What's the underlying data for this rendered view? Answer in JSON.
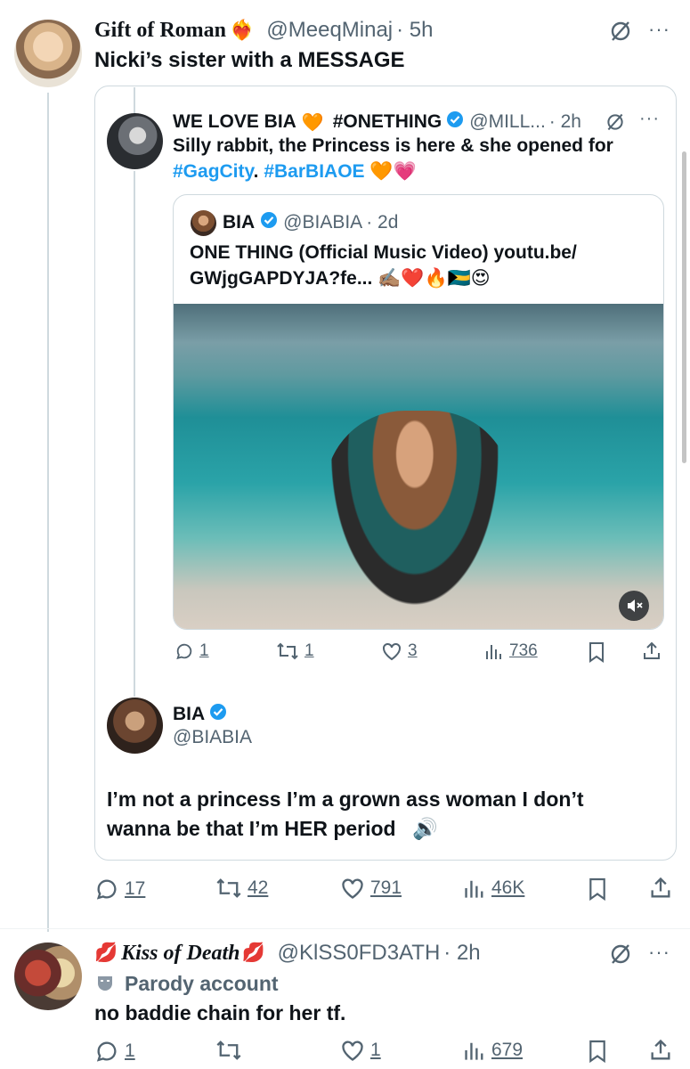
{
  "tweet1": {
    "display_name": "Gift of Roman",
    "display_emoji": "❤️‍🔥",
    "handle": "@MeeqMinaj",
    "time": "· 5h",
    "text": "Nicki’s sister with a MESSAGE",
    "stats": {
      "replies": "17",
      "reposts": "42",
      "likes": "791",
      "views": "46K"
    }
  },
  "quote1": {
    "display_name": "WE LOVE BIA",
    "name_emoji": "🧡",
    "display_name_2": "#ONETHING",
    "handle": "@MILL...",
    "time": "· 2h",
    "text_line1": "Silly rabbit, the Princess is here & she opened for",
    "tag1": "#GagCity",
    "dot": ".",
    "tag2": "#BarBIAOE",
    "tag_emoji": "🧡💗",
    "stats": {
      "replies": "1",
      "reposts": "1",
      "likes": "3",
      "views": "736"
    }
  },
  "quote2": {
    "display_name": "BIA",
    "handle": "@BIABIA",
    "time": "· 2d",
    "text_line1": "ONE THING (Official Music Video) youtu.be/",
    "text_line2": "GWjgGAPDYJA?fe...",
    "text_emoji": "✍🏽❤️🔥🇧🇸😍"
  },
  "embedded_post": {
    "display_name": "BIA",
    "handle": "@BIABIA",
    "text_line1": "I’m not a princess I’m a grown ass woman I don’t",
    "text_line2": "wanna be that I’m HER period",
    "text_emoji": "🔊"
  },
  "tweet2": {
    "display_name": "Kiss of Death",
    "name_emoji": "💋",
    "handle": "@KlSS0FD3ATH",
    "time": "· 2h",
    "parody_label": "Parody account",
    "text": "no baddie chain for her tf.",
    "stats": {
      "replies": "1",
      "reposts": "",
      "likes": "1",
      "views": "679"
    }
  },
  "colors": {
    "accent": "#1d9bf0",
    "muted": "#536471",
    "border": "#cfd9de"
  }
}
